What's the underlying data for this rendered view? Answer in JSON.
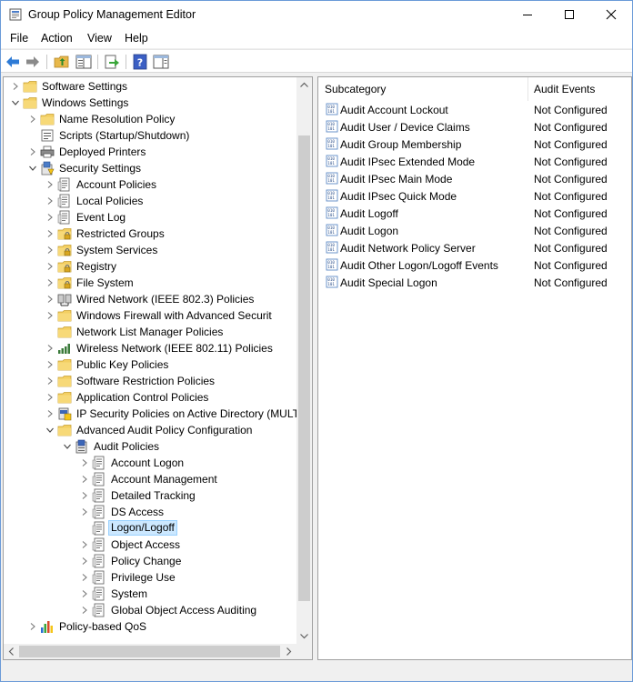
{
  "window": {
    "title": "Group Policy Management Editor"
  },
  "menu": {
    "file": "File",
    "action": "Action",
    "view": "View",
    "help": "Help"
  },
  "tree": [
    {
      "label": "Software Settings",
      "level": 0,
      "expander": "collapsed",
      "icon": "folder-icon"
    },
    {
      "label": "Windows Settings",
      "level": 0,
      "expander": "expanded",
      "icon": "folder-icon"
    },
    {
      "label": "Name Resolution Policy",
      "level": 1,
      "expander": "collapsed",
      "icon": "folder-icon"
    },
    {
      "label": "Scripts (Startup/Shutdown)",
      "level": 1,
      "expander": "none",
      "icon": "script-icon"
    },
    {
      "label": "Deployed Printers",
      "level": 1,
      "expander": "collapsed",
      "icon": "printer-icon"
    },
    {
      "label": "Security Settings",
      "level": 1,
      "expander": "expanded",
      "icon": "security-settings-icon"
    },
    {
      "label": "Account Policies",
      "level": 2,
      "expander": "collapsed",
      "icon": "policy-doc-icon"
    },
    {
      "label": "Local Policies",
      "level": 2,
      "expander": "collapsed",
      "icon": "policy-doc-icon"
    },
    {
      "label": "Event Log",
      "level": 2,
      "expander": "collapsed",
      "icon": "policy-doc-icon"
    },
    {
      "label": "Restricted Groups",
      "level": 2,
      "expander": "collapsed",
      "icon": "locked-folder-icon"
    },
    {
      "label": "System Services",
      "level": 2,
      "expander": "collapsed",
      "icon": "locked-folder-icon"
    },
    {
      "label": "Registry",
      "level": 2,
      "expander": "collapsed",
      "icon": "locked-folder-icon"
    },
    {
      "label": "File System",
      "level": 2,
      "expander": "collapsed",
      "icon": "locked-folder-icon"
    },
    {
      "label": "Wired Network (IEEE 802.3) Policies",
      "level": 2,
      "expander": "collapsed",
      "icon": "wired-network-icon"
    },
    {
      "label": "Windows Firewall with Advanced Securit",
      "level": 2,
      "expander": "collapsed",
      "icon": "folder-icon"
    },
    {
      "label": "Network List Manager Policies",
      "level": 2,
      "expander": "none",
      "icon": "folder-icon"
    },
    {
      "label": "Wireless Network (IEEE 802.11) Policies",
      "level": 2,
      "expander": "collapsed",
      "icon": "wireless-network-icon"
    },
    {
      "label": "Public Key Policies",
      "level": 2,
      "expander": "collapsed",
      "icon": "folder-icon"
    },
    {
      "label": "Software Restriction Policies",
      "level": 2,
      "expander": "collapsed",
      "icon": "folder-icon"
    },
    {
      "label": "Application Control Policies",
      "level": 2,
      "expander": "collapsed",
      "icon": "folder-icon"
    },
    {
      "label": "IP Security Policies on Active Directory (MULTI",
      "level": 2,
      "expander": "collapsed",
      "icon": "ip-security-icon"
    },
    {
      "label": "Advanced Audit Policy Configuration",
      "level": 2,
      "expander": "expanded",
      "icon": "folder-icon"
    },
    {
      "label": "Audit Policies",
      "level": 3,
      "expander": "expanded",
      "icon": "audit-policies-icon"
    },
    {
      "label": "Account Logon",
      "level": 4,
      "expander": "collapsed",
      "icon": "policy-doc-icon"
    },
    {
      "label": "Account Management",
      "level": 4,
      "expander": "collapsed",
      "icon": "policy-doc-icon"
    },
    {
      "label": "Detailed Tracking",
      "level": 4,
      "expander": "collapsed",
      "icon": "policy-doc-icon"
    },
    {
      "label": "DS Access",
      "level": 4,
      "expander": "collapsed",
      "icon": "policy-doc-icon"
    },
    {
      "label": "Logon/Logoff",
      "level": 4,
      "expander": "none",
      "icon": "policy-doc-icon",
      "selected": true
    },
    {
      "label": "Object Access",
      "level": 4,
      "expander": "collapsed",
      "icon": "policy-doc-icon"
    },
    {
      "label": "Policy Change",
      "level": 4,
      "expander": "collapsed",
      "icon": "policy-doc-icon"
    },
    {
      "label": "Privilege Use",
      "level": 4,
      "expander": "collapsed",
      "icon": "policy-doc-icon"
    },
    {
      "label": "System",
      "level": 4,
      "expander": "collapsed",
      "icon": "policy-doc-icon"
    },
    {
      "label": "Global Object Access Auditing",
      "level": 4,
      "expander": "collapsed",
      "icon": "policy-doc-icon"
    },
    {
      "label": "Policy-based QoS",
      "level": 1,
      "expander": "collapsed",
      "icon": "qos-chart-icon"
    }
  ],
  "list": {
    "columns": {
      "subcategory": "Subcategory",
      "audit_events": "Audit Events"
    },
    "rows": [
      {
        "name": "Audit Account Lockout",
        "value": "Not Configured"
      },
      {
        "name": "Audit User / Device Claims",
        "value": "Not Configured"
      },
      {
        "name": "Audit Group Membership",
        "value": "Not Configured"
      },
      {
        "name": "Audit IPsec Extended Mode",
        "value": "Not Configured"
      },
      {
        "name": "Audit IPsec Main Mode",
        "value": "Not Configured"
      },
      {
        "name": "Audit IPsec Quick Mode",
        "value": "Not Configured"
      },
      {
        "name": "Audit Logoff",
        "value": "Not Configured"
      },
      {
        "name": "Audit Logon",
        "value": "Not Configured"
      },
      {
        "name": "Audit Network Policy Server",
        "value": "Not Configured"
      },
      {
        "name": "Audit Other Logon/Logoff Events",
        "value": "Not Configured"
      },
      {
        "name": "Audit Special Logon",
        "value": "Not Configured"
      }
    ]
  },
  "colors": {
    "selection_bg": "#cce8ff",
    "selection_border": "#99d1ff",
    "folder": "#f3cf62",
    "window_border": "#6b9bd8"
  }
}
